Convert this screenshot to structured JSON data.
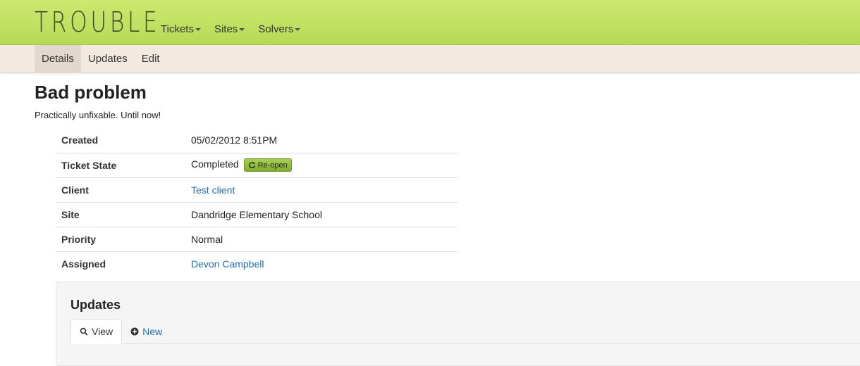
{
  "brand": "TROUBLE",
  "nav": {
    "items": [
      {
        "label": "Tickets"
      },
      {
        "label": "Sites"
      },
      {
        "label": "Solvers"
      }
    ]
  },
  "subnav": {
    "tabs": [
      {
        "label": "Details",
        "active": true
      },
      {
        "label": "Updates",
        "active": false
      },
      {
        "label": "Edit",
        "active": false
      }
    ]
  },
  "ticket": {
    "title": "Bad problem",
    "description": "Practically unfixable. Until now!",
    "fields": {
      "created": {
        "label": "Created",
        "value": "05/02/2012 8:51PM"
      },
      "state": {
        "label": "Ticket State",
        "value": "Completed",
        "action_label": "Re-open"
      },
      "client": {
        "label": "Client",
        "value": "Test client"
      },
      "site": {
        "label": "Site",
        "value": "Dandridge Elementary School"
      },
      "priority": {
        "label": "Priority",
        "value": "Normal"
      },
      "assigned": {
        "label": "Assigned",
        "value": "Devon Campbell"
      }
    }
  },
  "updates": {
    "title": "Updates",
    "tabs": [
      {
        "label": "View",
        "icon": "search-icon",
        "active": true
      },
      {
        "label": "New",
        "icon": "plus-circle-icon",
        "active": false
      }
    ]
  },
  "colors": {
    "navbar": "#c4e366",
    "subnav": "#f2e9e0",
    "link": "#1f6fb2",
    "reopen_button": "#8fbc3a"
  }
}
